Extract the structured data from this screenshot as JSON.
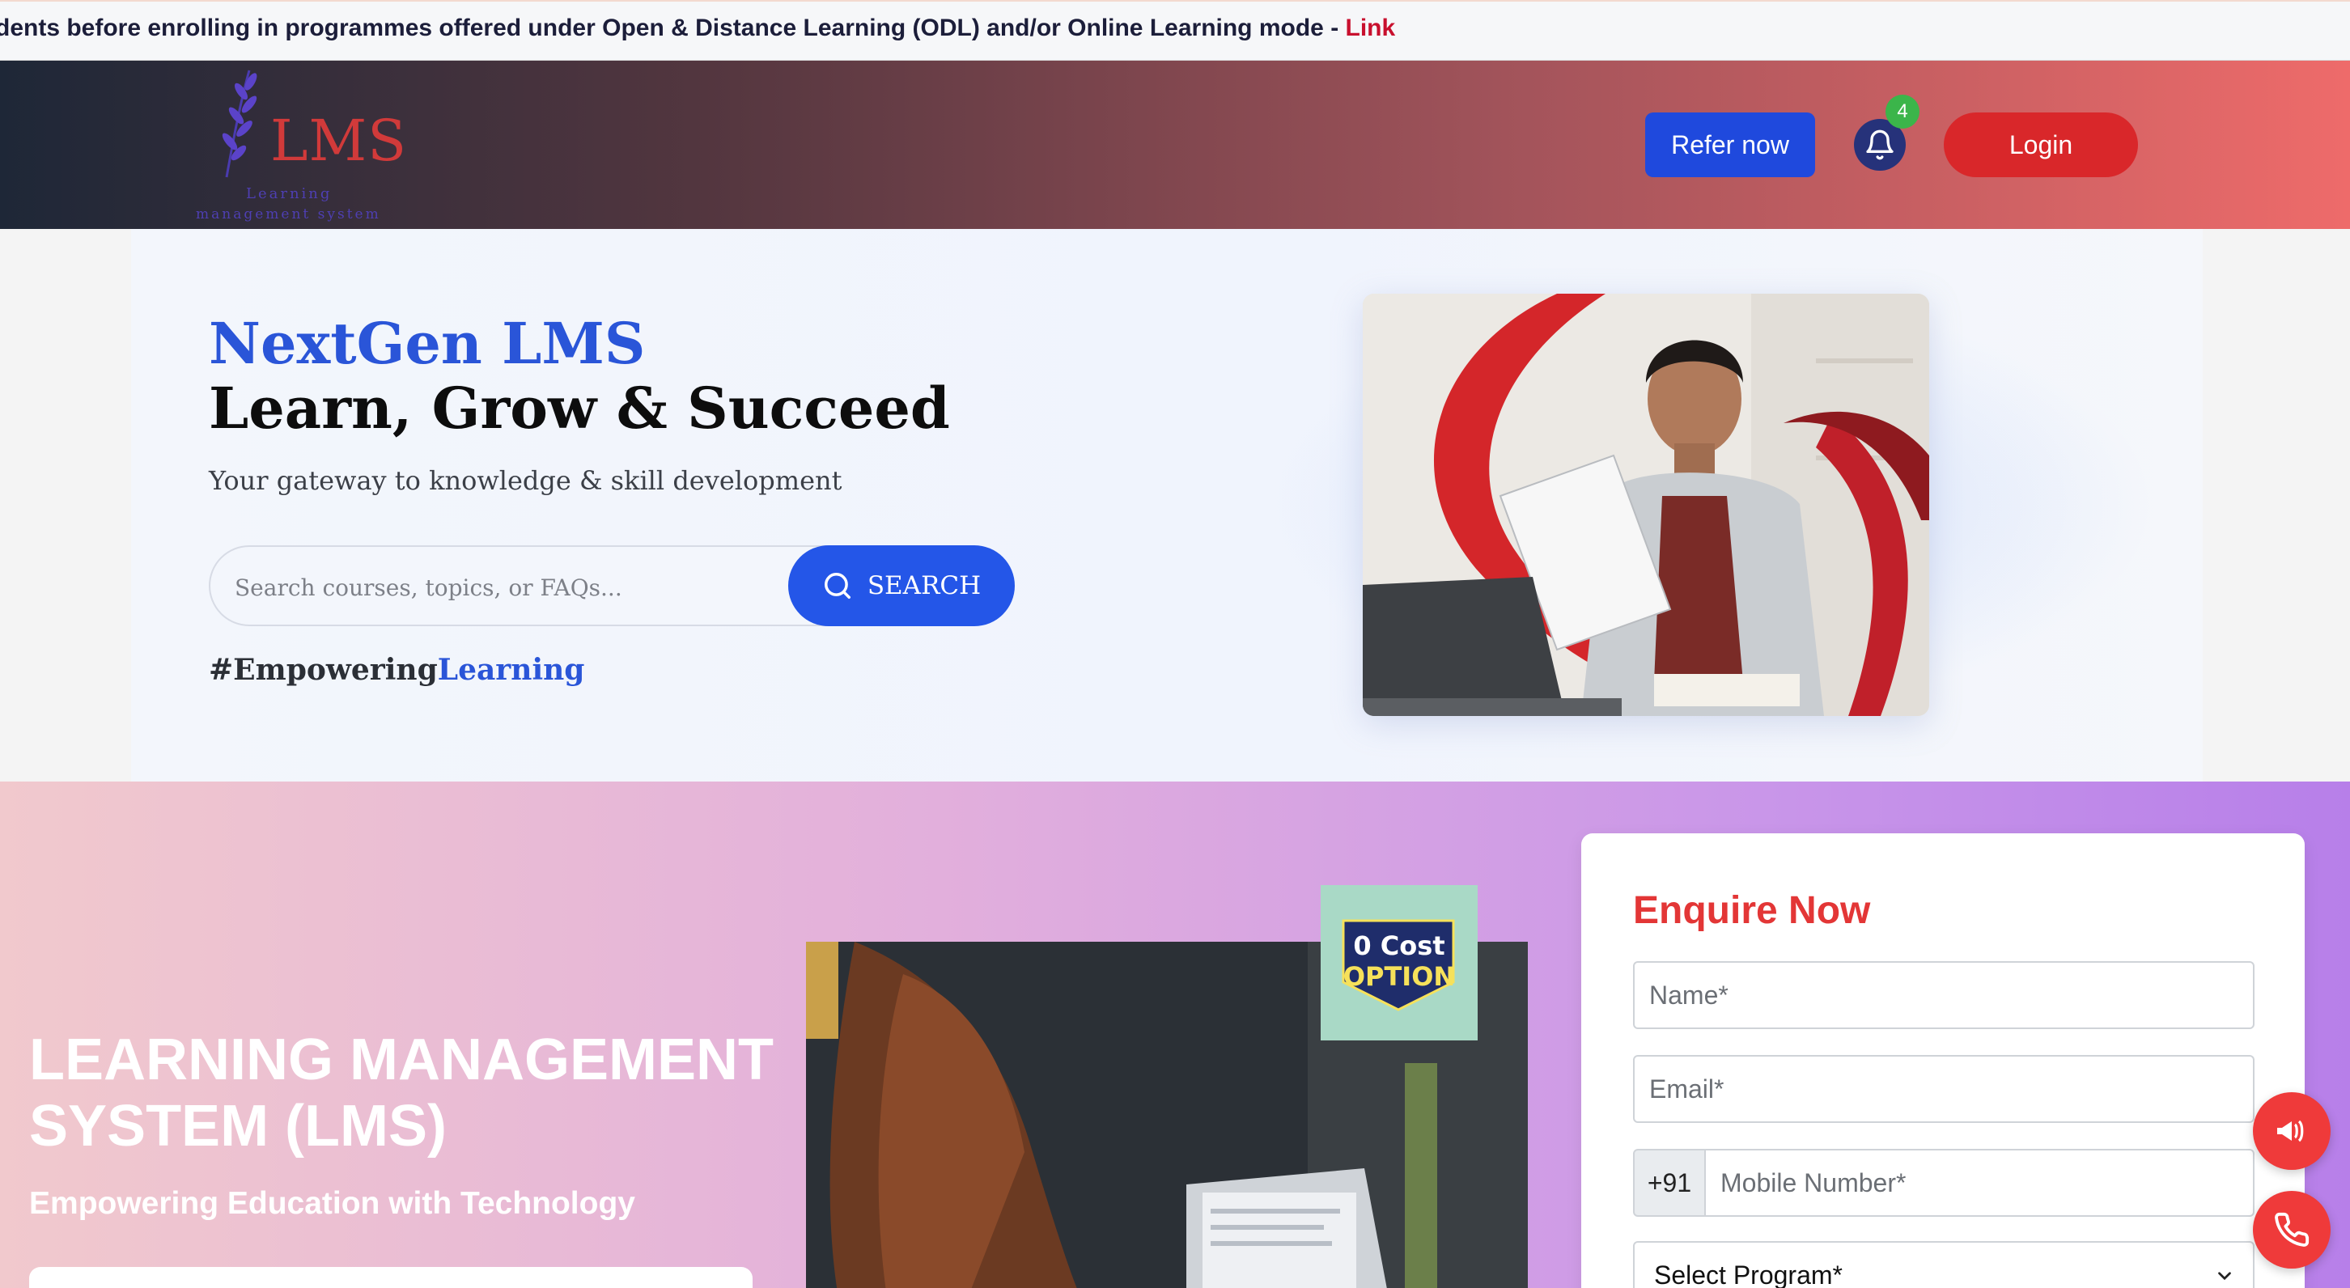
{
  "notice": {
    "text": "dents before enrolling in programmes offered under Open & Distance Learning (ODL) and/or Online Learning mode - ",
    "link_label": "Link"
  },
  "header": {
    "logo": {
      "text": "LMS",
      "sub1": "Learning",
      "sub2": "management system"
    },
    "refer_label": "Refer now",
    "notification_count": "4",
    "login_label": "Login"
  },
  "hero": {
    "brand": "NextGen LMS",
    "title": "Learn, Grow & Succeed",
    "subtitle": "Your gateway to knowledge & skill development",
    "search_placeholder": "Search courses, topics, or FAQs...",
    "search_label": "SEARCH",
    "hashtag_prefix": "#Empowering",
    "hashtag_highlight": "Learning"
  },
  "section2": {
    "title_line1": "LEARNING MANAGEMENT",
    "title_line2": "SYSTEM (LMS)",
    "subtitle": "Empowering Education with Technology",
    "badge_line1": "0 Cost",
    "badge_line2": "OPTION"
  },
  "enquire": {
    "title": "Enquire Now",
    "name_placeholder": "Name*",
    "email_placeholder": "Email*",
    "country_code": "+91",
    "mobile_placeholder": "Mobile Number*",
    "program_label": "Select Program*"
  },
  "colors": {
    "accent_blue": "#2456e8",
    "accent_red": "#d9272a",
    "badge_green": "#3bb54a"
  },
  "icons": [
    "bell-icon",
    "search-icon",
    "megaphone-icon",
    "phone-icon",
    "chevron-down-icon",
    "leaf-icon"
  ]
}
